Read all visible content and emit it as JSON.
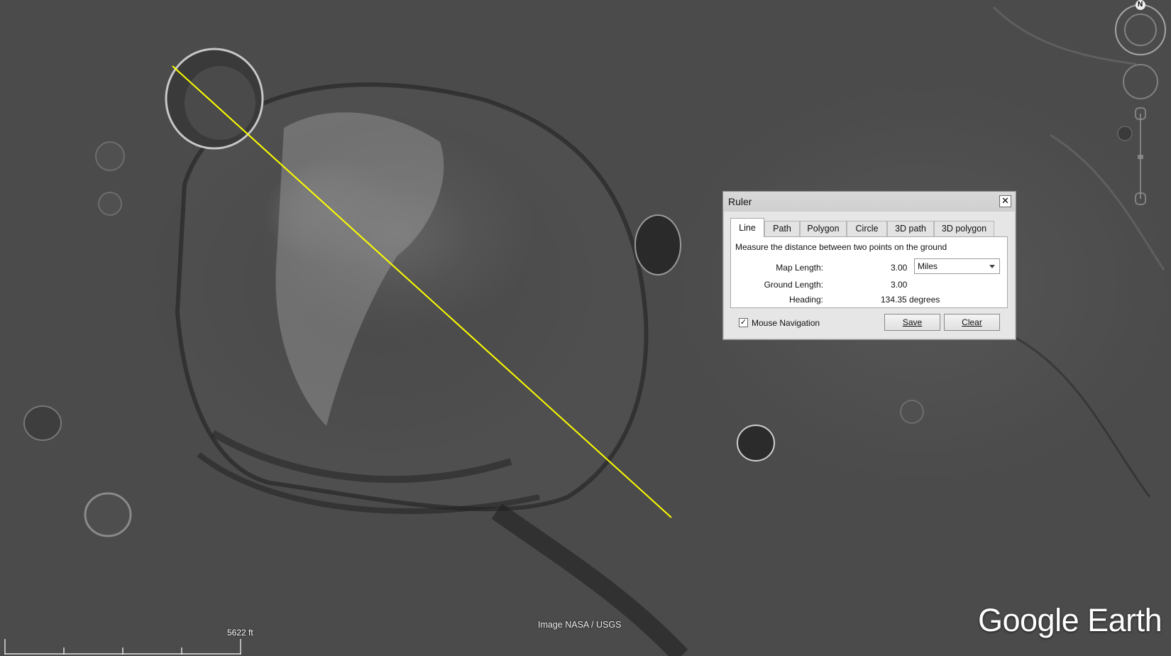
{
  "map": {
    "attribution": "Image NASA / USGS",
    "scale_label": "5622 ft",
    "logo": {
      "word1": "Google",
      "word2": "Earth"
    },
    "measure_line_color": "#ffff00"
  },
  "navigation": {
    "north_label": "N"
  },
  "ruler": {
    "title": "Ruler",
    "close_glyph": "✕",
    "tabs": [
      {
        "label": "Line",
        "active": true
      },
      {
        "label": "Path"
      },
      {
        "label": "Polygon"
      },
      {
        "label": "Circle"
      },
      {
        "label": "3D path"
      },
      {
        "label": "3D polygon"
      }
    ],
    "description": "Measure the distance between two points on the ground",
    "map_length_label": "Map Length:",
    "map_length_value": "3.00",
    "unit": "Miles",
    "ground_length_label": "Ground Length:",
    "ground_length_value": "3.00",
    "heading_label": "Heading:",
    "heading_value": "134.35 degrees",
    "mouse_navigation": {
      "label": "Mouse Navigation",
      "checked": true,
      "glyph": "✓"
    },
    "save_label": "Save",
    "clear_label": "Clear"
  }
}
